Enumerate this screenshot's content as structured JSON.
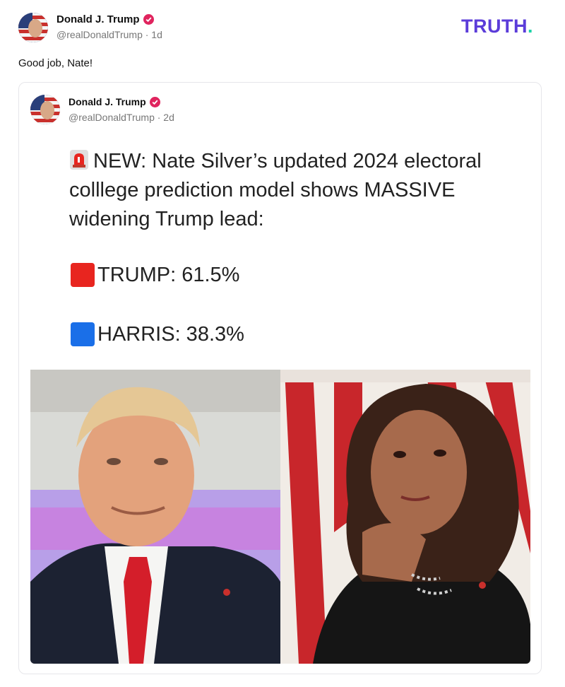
{
  "post": {
    "author_name": "Donald J. Trump",
    "author_handle": "@realDonaldTrump · 1d",
    "text": "Good job, Nate!"
  },
  "brand": {
    "logo_text": "TRUTH",
    "logo_dot": "."
  },
  "quoted": {
    "author_name": "Donald J. Trump",
    "author_handle": "@realDonaldTrump · 2d",
    "headline": "NEW: Nate Silver’s updated 2024 electoral colllege prediction model shows MASSIVE widening Trump lead:",
    "trump_line": "TRUMP: 61.5%",
    "harris_line": "HARRIS: 38.3%",
    "image_alt": "Side-by-side photos of Donald Trump and Kamala Harris"
  },
  "colors": {
    "brand_purple": "#5b3cd9",
    "brand_teal": "#1bd3a8",
    "verified_red": "#e0245e",
    "trump_red": "#e8251f",
    "harris_blue": "#1a6fe8"
  },
  "icons": [
    "verified-badge-icon",
    "siren-icon",
    "red-square-icon",
    "blue-square-icon"
  ]
}
